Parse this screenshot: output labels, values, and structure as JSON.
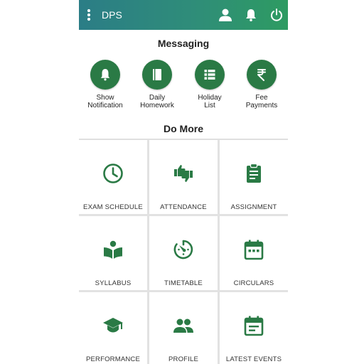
{
  "appbar": {
    "title": "DPS",
    "icons": [
      "menu-icon",
      "user-icon",
      "bell-icon",
      "power-icon"
    ]
  },
  "messaging": {
    "title": "Messaging",
    "items": [
      {
        "label": "Show\nNotification",
        "icon": "bell-icon"
      },
      {
        "label": "Daily\nHomework",
        "icon": "book-icon"
      },
      {
        "label": "Holiday\nList",
        "icon": "list-icon"
      },
      {
        "label": "Fee\nPayments",
        "icon": "rupee-icon"
      }
    ]
  },
  "do_more": {
    "title": "Do More",
    "tiles": [
      {
        "label": "EXAM SCHEDULE",
        "icon": "clock-icon"
      },
      {
        "label": "ATTENDANCE",
        "icon": "thumbs-icon"
      },
      {
        "label": "ASSIGNMENT",
        "icon": "clipboard-icon"
      },
      {
        "label": "SYLLABUS",
        "icon": "reader-icon"
      },
      {
        "label": "TIMETABLE",
        "icon": "timer-icon"
      },
      {
        "label": "CIRCULARS",
        "icon": "calendar-icon"
      },
      {
        "label": "PERFORMANCE",
        "icon": "graduation-cap-icon"
      },
      {
        "label": "PROFILE",
        "icon": "people-icon"
      },
      {
        "label": "LATEST EVENTS",
        "icon": "event-note-icon"
      }
    ]
  },
  "colors": {
    "appbar_start": "#2b7d86",
    "appbar_end": "#2e9b62",
    "accent_green": "#2a7a45"
  }
}
